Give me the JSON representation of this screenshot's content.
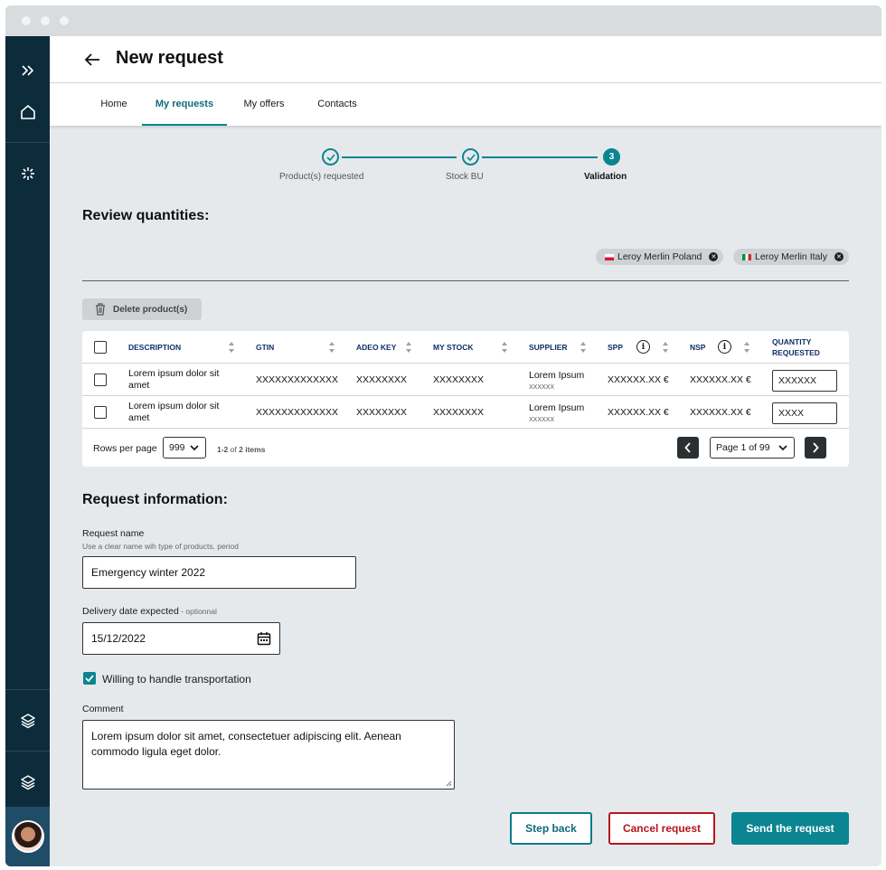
{
  "header": {
    "title": "New request"
  },
  "tabs": [
    {
      "label": "Home"
    },
    {
      "label": "My requests"
    },
    {
      "label": "My offers"
    },
    {
      "label": "Contacts"
    }
  ],
  "stepper": [
    {
      "label": "Product(s) requested",
      "state": "done"
    },
    {
      "label": "Stock BU",
      "state": "done"
    },
    {
      "number": "3",
      "label": "Validation",
      "state": "active"
    }
  ],
  "review": {
    "title": "Review quantities:",
    "chips": [
      {
        "label": "Leroy Merlin Poland"
      },
      {
        "label": "Leroy Merlin Italy"
      }
    ],
    "delete_label": "Delete product(s)"
  },
  "table": {
    "columns": [
      "DESCRIPTION",
      "GTIN",
      "ADEO KEY",
      "MY STOCK",
      "SUPPLIER",
      "SPP",
      "NSP",
      "QUANTITY",
      "REQUESTED"
    ],
    "rows": [
      {
        "desc1": "Lorem ipsum dolor sit",
        "desc2": "amet",
        "gtin": "XXXXXXXXXXXXX",
        "adeo": "XXXXXXXX",
        "stock": "XXXXXXXX",
        "supplier": "Lorem Ipsum",
        "supplier_code": "XXXXXX",
        "spp": "XXXXXX.XX €",
        "nsp": "XXXXXX.XX €",
        "qty": "XXXXXX"
      },
      {
        "desc1": "Lorem ipsum dolor sit",
        "desc2": "amet",
        "gtin": "XXXXXXXXXXXXX",
        "adeo": "XXXXXXXX",
        "stock": "XXXXXXXX",
        "supplier": "Lorem Ipsum",
        "supplier_code": "XXXXXX",
        "spp": "XXXXXX.XX €",
        "nsp": "XXXXXX.XX €",
        "qty": "XXXX"
      }
    ],
    "pager": {
      "rows_per_page_label": "Rows per page",
      "rows_per_page_value": "999",
      "range": "1-2",
      "of_label": "of",
      "total": "2 items",
      "page_label": "Page 1 of 99"
    }
  },
  "request_info": {
    "title": "Request information:",
    "name_label": "Request name",
    "name_hint": "Use a clear name wih type of products, period",
    "name_value": "Emergency winter 2022",
    "date_label": "Delivery date expected",
    "date_optional": " - optionnal",
    "date_value": "15/12/2022",
    "transport_label": "Willing to handle transportation",
    "transport_checked": true,
    "comment_label": "Comment",
    "comment_line1": "Lorem ipsum dolor sit amet, consectetuer adipiscing elit. Aenean",
    "comment_line2": "commodo ligula eget dolor."
  },
  "actions": {
    "step_back": "Step back",
    "cancel": "Cancel request",
    "send": "Send the request"
  },
  "colors": {
    "sidebar": "#0c2b3b",
    "accent": "#0b8591",
    "danger": "#b8141d",
    "background": "#e6e9ec"
  }
}
